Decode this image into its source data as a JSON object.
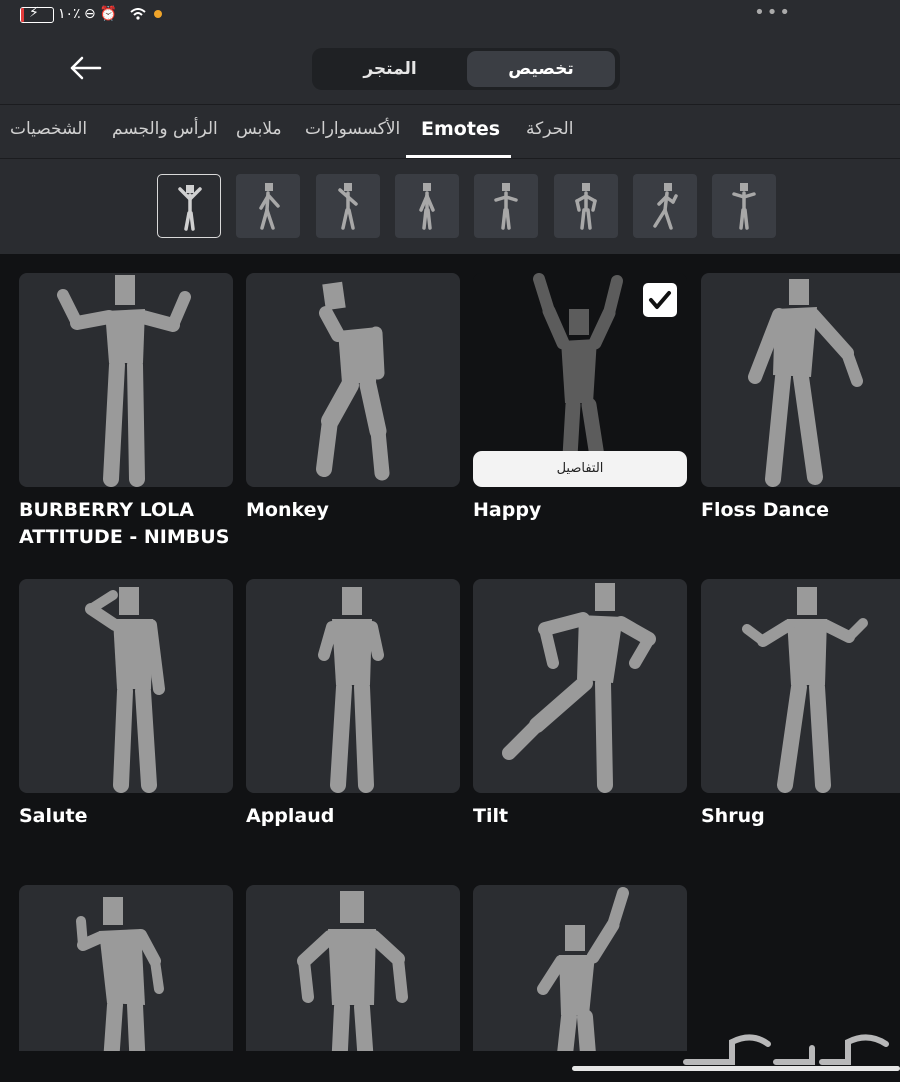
{
  "status_bar": {
    "battery_level": 0.1,
    "battery_text": "٪١٠",
    "icons": [
      "charging-icon",
      "dnd-icon",
      "alarm-icon",
      "wifi-icon",
      "notification-dot-icon"
    ],
    "menu_dots": "•••"
  },
  "header": {
    "back_icon": "arrow-left-icon",
    "tabs": [
      {
        "label": "المتجر",
        "active": false
      },
      {
        "label": "تخصيص",
        "active": true
      }
    ]
  },
  "category_tabs": [
    {
      "label": "الشخصيات",
      "active": false
    },
    {
      "label": "الرأس والجسم",
      "active": false
    },
    {
      "label": "ملابس",
      "active": false
    },
    {
      "label": "الأكسسوارات",
      "active": false
    },
    {
      "label": "Emotes",
      "active": true
    },
    {
      "label": "الحركة",
      "active": false
    }
  ],
  "subcategories": [
    {
      "icon": "emote-pose-icon-1",
      "selected": true
    },
    {
      "icon": "emote-pose-icon-2",
      "selected": false
    },
    {
      "icon": "emote-pose-icon-3",
      "selected": false
    },
    {
      "icon": "emote-pose-icon-4",
      "selected": false
    },
    {
      "icon": "emote-pose-icon-5",
      "selected": false
    },
    {
      "icon": "emote-pose-icon-6",
      "selected": false
    },
    {
      "icon": "emote-pose-icon-7",
      "selected": false
    },
    {
      "icon": "emote-pose-icon-8",
      "selected": false
    }
  ],
  "emotes": [
    {
      "title_line1": "BURBERRY LOLA",
      "title_line2": "ATTITUDE - NIMBUS",
      "selected": false
    },
    {
      "title_line1": "Monkey",
      "title_line2": "",
      "selected": false
    },
    {
      "title_line1": "Happy",
      "title_line2": "",
      "selected": true,
      "details_label": "التفاصيل"
    },
    {
      "title_line1": "Floss Dance",
      "title_line2": "",
      "selected": false
    },
    {
      "title_line1": "Salute",
      "title_line2": "",
      "selected": false
    },
    {
      "title_line1": "Applaud",
      "title_line2": "",
      "selected": false
    },
    {
      "title_line1": "Tilt",
      "title_line2": "",
      "selected": false
    },
    {
      "title_line1": "Shrug",
      "title_line2": "",
      "selected": false
    },
    {
      "title_line1": "",
      "title_line2": "",
      "selected": false
    },
    {
      "title_line1": "",
      "title_line2": "",
      "selected": false
    },
    {
      "title_line1": "",
      "title_line2": "",
      "selected": false
    }
  ],
  "colors": {
    "background": "#111214",
    "panel": "#2a2c30",
    "card": "#2b2d31",
    "figure": "#9a9a9a",
    "battery_low": "#e23b3b",
    "notification_dot": "#f0a52a"
  }
}
